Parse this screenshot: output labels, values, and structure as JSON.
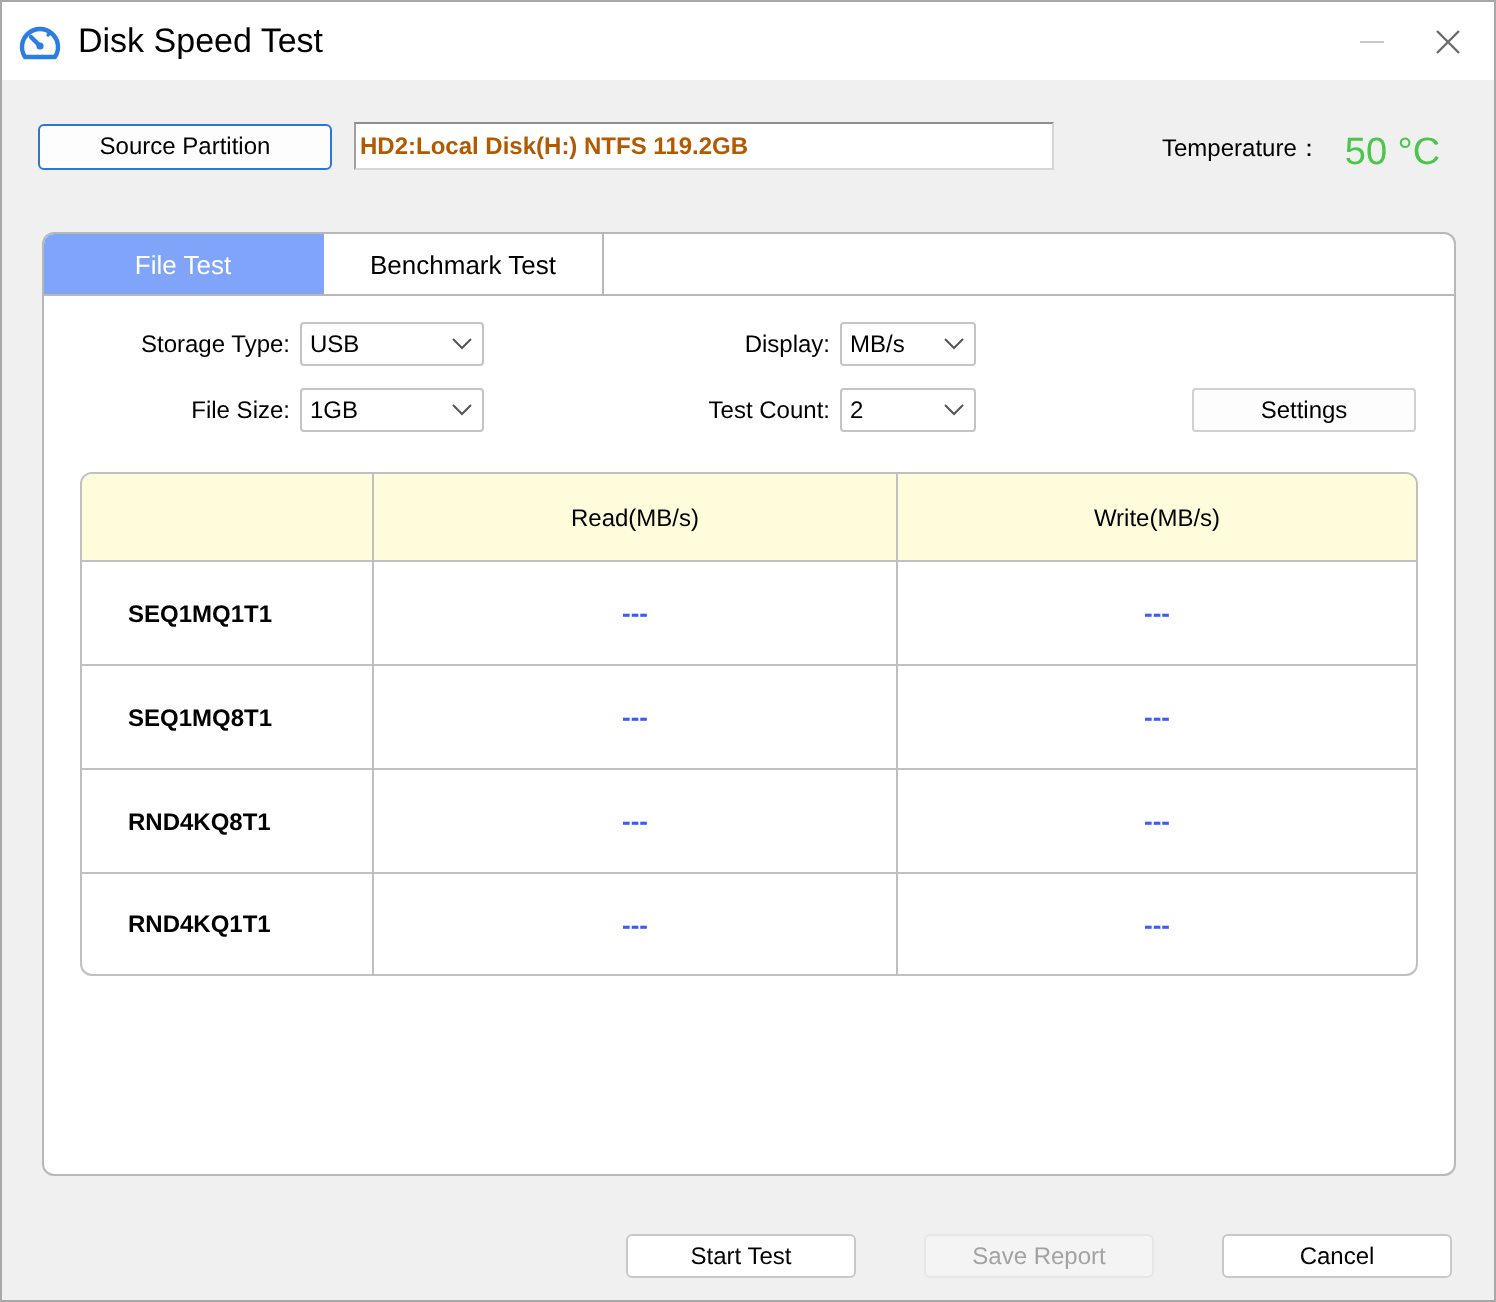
{
  "window": {
    "title": "Disk Speed Test"
  },
  "source": {
    "button": "Source Partition",
    "value": "HD2:Local Disk(H:) NTFS 119.2GB"
  },
  "temperature": {
    "label": "Temperature：",
    "value": "50 °C"
  },
  "tabs": [
    {
      "label": "File Test",
      "selected": true
    },
    {
      "label": "Benchmark Test",
      "selected": false
    }
  ],
  "options": [
    {
      "label": "Storage Type:",
      "value": "USB"
    },
    {
      "label": "Display:",
      "value": "MB/s"
    },
    {
      "label": "File Size:",
      "value": "1GB"
    },
    {
      "label": "Test Count:",
      "value": "2"
    }
  ],
  "settings_button": "Settings",
  "table": {
    "columns": [
      "Read(MB/s)",
      "Write(MB/s)"
    ],
    "rows": [
      {
        "name": "SEQ1MQ1T1",
        "read": "---",
        "write": "---"
      },
      {
        "name": "SEQ1MQ8T1",
        "read": "---",
        "write": "---"
      },
      {
        "name": "RND4KQ8T1",
        "read": "---",
        "write": "---"
      },
      {
        "name": "RND4KQ1T1",
        "read": "---",
        "write": "---"
      }
    ]
  },
  "buttons": [
    {
      "label": "Start Test",
      "disabled": false
    },
    {
      "label": "Save Report",
      "disabled": true
    },
    {
      "label": "Cancel",
      "disabled": false
    }
  ]
}
